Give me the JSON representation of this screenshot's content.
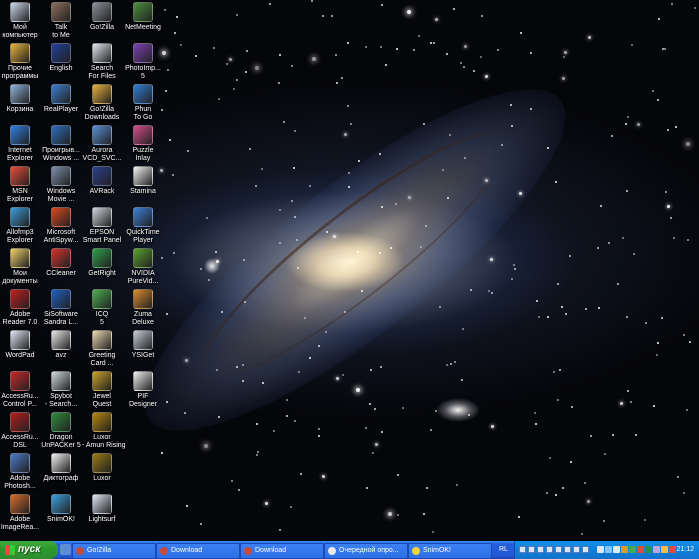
{
  "desktop": {
    "icons": [
      {
        "label": "Мой компьютер",
        "icon": "my-computer-icon",
        "color": "#c9d6ea"
      },
      {
        "label": "Прочие программы",
        "icon": "programs-folder-icon",
        "color": "#e7b23b"
      },
      {
        "label": "Корзина",
        "icon": "recycle-bin-icon",
        "color": "#8fb3d9"
      },
      {
        "label": "Internet Explorer",
        "icon": "internet-explorer-icon",
        "color": "#2f7fe0"
      },
      {
        "label": "MSN Explorer",
        "icon": "msn-butterfly-icon",
        "color": "#e84b3a"
      },
      {
        "label": "Allofmp3 Explorer",
        "icon": "allofmp3-icon",
        "color": "#3d9ad8"
      },
      {
        "label": "Мои документы",
        "icon": "my-documents-icon",
        "color": "#f0cf6a"
      },
      {
        "label": "Adobe Reader 7.0",
        "icon": "adobe-reader-icon",
        "color": "#c21f1f"
      },
      {
        "label": "WordPad",
        "icon": "wordpad-icon",
        "color": "#dfe6f3"
      },
      {
        "label": "AccessRu... Control P...",
        "icon": "accessru-control-icon",
        "color": "#c62828"
      },
      {
        "label": "AccessRu... DSL",
        "icon": "accessru-dsl-icon",
        "color": "#b71c1c"
      },
      {
        "label": "Adobe Photosh...",
        "icon": "photoshop-icon",
        "color": "#4a79c8"
      },
      {
        "label": "Adobe ImageRea...",
        "icon": "imageready-icon",
        "color": "#d86a2a"
      },
      {
        "label": "Talk to Me",
        "icon": "talk-to-me-icon",
        "color": "#8a6d5a"
      },
      {
        "label": "English",
        "icon": "english-flag-icon",
        "color": "#1f3f9a"
      },
      {
        "label": "RealPlayer",
        "icon": "realplayer-icon",
        "color": "#3b7ed0"
      },
      {
        "label": "Проигрыв... Windows ...",
        "icon": "windows-media-player-icon",
        "color": "#2d6dbd"
      },
      {
        "label": "Windows Movie ...",
        "icon": "movie-maker-icon",
        "color": "#7a8ea8"
      },
      {
        "label": "Microsoft AntiSpyw...",
        "icon": "antispyware-icon",
        "color": "#d9481f"
      },
      {
        "label": "CCleaner",
        "icon": "ccleaner-icon",
        "color": "#d3322d"
      },
      {
        "label": "SiSoftware Sandra L...",
        "icon": "sisoftware-sandra-icon",
        "color": "#1e5fc2"
      },
      {
        "label": "avz",
        "icon": "avz-icon",
        "color": "#e6e6e6"
      },
      {
        "label": "Spybot - Search...",
        "icon": "spybot-icon",
        "color": "#cfd8dc"
      },
      {
        "label": "Dragon UnPACKer 5",
        "icon": "dragon-unpacker-icon",
        "color": "#2e8b3d"
      },
      {
        "label": "Диктограф",
        "icon": "diktograf-icon",
        "color": "#f0f0f0"
      },
      {
        "label": "SnimOK!",
        "icon": "snimok-icon",
        "color": "#3aa0e0"
      },
      {
        "label": "Go!Zilla",
        "icon": "gozilla-icon",
        "color": "#8a8f98"
      },
      {
        "label": "Search For Files",
        "icon": "search-files-icon",
        "color": "#e0e6ee"
      },
      {
        "label": "Go!Zilla Downloads",
        "icon": "downloads-folder-icon",
        "color": "#e7b23b"
      },
      {
        "label": "Aurora VCD_SVC...",
        "icon": "aurora-vcd-icon",
        "color": "#5a8fd6"
      },
      {
        "label": "AVRack",
        "icon": "avrack-icon",
        "color": "#2a3e8c"
      },
      {
        "label": "EPSON Smart Panel",
        "icon": "epson-smart-panel-icon",
        "color": "#cfd4da"
      },
      {
        "label": "GetRight",
        "icon": "getright-icon",
        "color": "#2f9e4b"
      },
      {
        "label": "ICQ 5",
        "icon": "icq-flower-icon",
        "color": "#4caf50"
      },
      {
        "label": "Greeting Card ...",
        "icon": "greeting-card-icon",
        "color": "#e8d8b0"
      },
      {
        "label": "Jewel Quest",
        "icon": "jewel-quest-icon",
        "color": "#c9a227"
      },
      {
        "label": "Luxor - Amun Rising",
        "icon": "luxor-amun-icon",
        "color": "#b8860b"
      },
      {
        "label": "Luxor",
        "icon": "luxor-icon",
        "color": "#9a7a14"
      },
      {
        "label": "Lightsurf",
        "icon": "lightsurf-icon",
        "color": "#dfe8f4"
      },
      {
        "label": "NetMeeting",
        "icon": "netmeeting-icon",
        "color": "#4a8e3b"
      },
      {
        "label": "PhotoImp... 5",
        "icon": "photoimpact-icon",
        "color": "#7b3fb3"
      },
      {
        "label": "Phun To Go",
        "icon": "phun-to-go-icon",
        "color": "#2e7dd6"
      },
      {
        "label": "Puzzle Inlay",
        "icon": "puzzle-inlay-icon",
        "color": "#d64a8a"
      },
      {
        "label": "Stamina",
        "icon": "stamina-icon",
        "color": "#f2f2f2"
      },
      {
        "label": "QuickTime Player",
        "icon": "quicktime-icon",
        "color": "#3b7fd9"
      },
      {
        "label": "NVIDIA PureVid...",
        "icon": "nvidia-icon",
        "color": "#5aa02c"
      },
      {
        "label": "Zuma Deluxe",
        "icon": "zuma-deluxe-icon",
        "color": "#d88a2a"
      },
      {
        "label": "YSIGet",
        "icon": "ysiget-icon",
        "color": "#c4ccd6"
      },
      {
        "label": "PIF Designer",
        "icon": "pif-designer-icon",
        "color": "#eeeeee"
      }
    ]
  },
  "taskbar": {
    "start_label": "пуск",
    "quick_launch": [
      {
        "icon": "show-desktop-icon",
        "color": "#5c8ed8"
      },
      {
        "icon": "ie-quicklaunch-icon",
        "color": "#7ac0ff"
      },
      {
        "icon": "media-player-quicklaunch-icon",
        "color": "#f08a30"
      }
    ],
    "tasks": [
      {
        "label": "Go!Zilla",
        "icon": "gozilla-task-icon",
        "color": "#c64b3a"
      },
      {
        "label": "Download",
        "icon": "download-task-icon",
        "color": "#c64b3a"
      },
      {
        "label": "Download",
        "icon": "download-task-icon",
        "color": "#c64b3a"
      },
      {
        "label": "Очередной опро...",
        "icon": "browser-task-icon",
        "color": "#e9e9e9"
      },
      {
        "label": "SnimOK!",
        "icon": "snimok-task-icon",
        "color": "#f2d23a"
      }
    ],
    "language": "RL",
    "clock": "21:12",
    "tray_icons": [
      {
        "icon": "tray-monitor-icon",
        "color": "#dfe8f4"
      },
      {
        "icon": "tray-network-icon",
        "color": "#8fc3ef"
      },
      {
        "icon": "tray-volume-icon",
        "color": "#e6e6e6"
      },
      {
        "icon": "tray-antivirus-icon",
        "color": "#d9a020"
      },
      {
        "icon": "tray-icq-icon",
        "color": "#42b04a"
      },
      {
        "icon": "tray-download-icon",
        "color": "#e05030"
      },
      {
        "icon": "tray-shield-icon",
        "color": "#2f8f4f"
      },
      {
        "icon": "tray-app-icon",
        "color": "#c8a0e0"
      },
      {
        "icon": "tray-app2-icon",
        "color": "#f0c040"
      },
      {
        "icon": "tray-app3-icon",
        "color": "#ee4444"
      }
    ],
    "media_controls": [
      {
        "icon": "media-stop-icon"
      },
      {
        "icon": "media-prev-icon"
      },
      {
        "icon": "media-play-icon"
      },
      {
        "icon": "media-pause-icon"
      },
      {
        "icon": "media-next-icon"
      },
      {
        "icon": "media-repeat-icon"
      },
      {
        "icon": "media-shuffle-icon"
      },
      {
        "icon": "media-volume-icon"
      }
    ]
  }
}
